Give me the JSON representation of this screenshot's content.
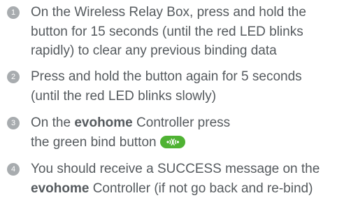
{
  "steps": [
    {
      "number": "1",
      "lines": [
        "On the Wireless Relay Box, press and hold the",
        "button for 15 seconds (until the red LED blinks",
        "rapidly) to clear any previous binding data"
      ]
    },
    {
      "number": "2",
      "lines": [
        "Press and hold the button again for 5 seconds",
        "(until the red LED blinks slowly)"
      ]
    },
    {
      "number": "3",
      "line1_before": "On the ",
      "line1_bold": "evohome",
      "line1_after": " Controller press",
      "line2": "the green bind button ",
      "icon": "bind-button-icon",
      "icon_color": "#4fb233"
    },
    {
      "number": "4",
      "line1": "You should receive a SUCCESS message on the",
      "line2_bold": "evohome",
      "line2_after": " Controller (if not go back and re-bind)"
    }
  ],
  "colors": {
    "text": "#555a5e",
    "step_badge": "#a8acaf"
  }
}
